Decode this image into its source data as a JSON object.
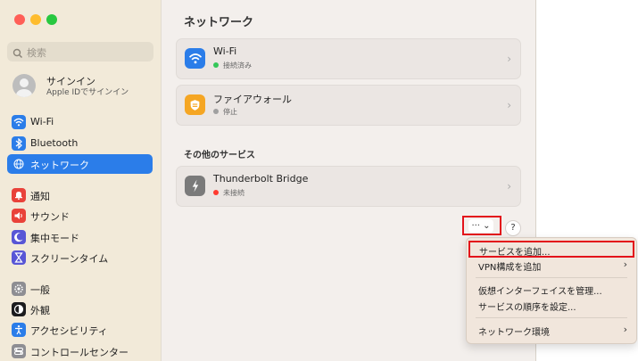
{
  "sidebar": {
    "search_placeholder": "検索",
    "account": {
      "name": "サインイン",
      "subtitle": "Apple IDでサインイン"
    },
    "items": [
      {
        "label": "Wi-Fi",
        "icon": "wifi-icon",
        "color": "#2b7de9"
      },
      {
        "label": "Bluetooth",
        "icon": "bluetooth-icon",
        "color": "#2b7de9"
      },
      {
        "label": "ネットワーク",
        "icon": "globe-icon",
        "color": "#2b7de9",
        "selected": true
      },
      {
        "label": "通知",
        "icon": "bell-icon",
        "color": "#e9423a"
      },
      {
        "label": "サウンド",
        "icon": "speaker-icon",
        "color": "#e9423a"
      },
      {
        "label": "集中モード",
        "icon": "moon-icon",
        "color": "#5856d6"
      },
      {
        "label": "スクリーンタイム",
        "icon": "hourglass-icon",
        "color": "#5856d6"
      },
      {
        "label": "一般",
        "icon": "gear-icon",
        "color": "#8e8e93"
      },
      {
        "label": "外観",
        "icon": "appearance-icon",
        "color": "#1c1c1e"
      },
      {
        "label": "アクセシビリティ",
        "icon": "accessibility-icon",
        "color": "#2b7de9"
      },
      {
        "label": "コントロールセンター",
        "icon": "control-center-icon",
        "color": "#8e8e93"
      }
    ]
  },
  "main": {
    "title": "ネットワーク",
    "services": [
      {
        "name": "Wi-Fi",
        "status": "接続済み",
        "status_color": "#34c759",
        "icon": "wifi-icon",
        "icon_color": "#2b7de9"
      },
      {
        "name": "ファイアウォール",
        "status": "停止",
        "status_color": "#a0a0a0",
        "icon": "firewall-icon",
        "icon_color": "#f5a623"
      }
    ],
    "other_title": "その他のサービス",
    "other_services": [
      {
        "name": "Thunderbolt Bridge",
        "status": "未接続",
        "status_color": "#ff3b30",
        "icon": "thunderbolt-icon",
        "icon_color": "#7a7a7a"
      }
    ],
    "more_button_label": "··· ⌄",
    "help_label": "?"
  },
  "menu": {
    "items": [
      {
        "label": "サービスを追加...",
        "highlighted": true
      },
      {
        "label": "VPN構成を追加",
        "submenu": true
      },
      {
        "label": "仮想インターフェイスを管理..."
      },
      {
        "label": "サービスの順序を設定..."
      },
      {
        "label": "ネットワーク環境",
        "submenu": true
      }
    ]
  }
}
